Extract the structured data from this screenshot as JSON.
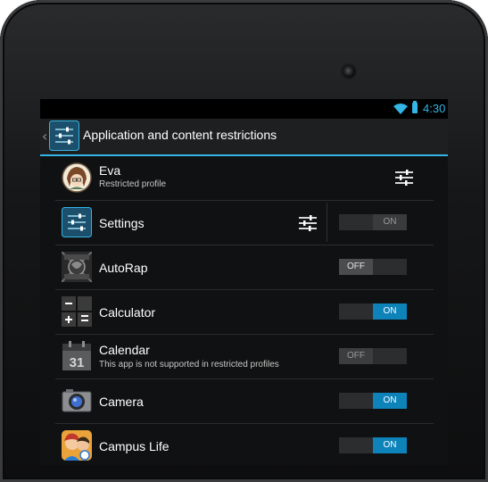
{
  "status_bar": {
    "time": "4:30",
    "wifi_icon": "wifi-icon",
    "battery_icon": "battery-icon",
    "accent": "#33b5e5"
  },
  "action_bar": {
    "title": "Application and content restrictions",
    "icon": "restrictions-sliders-icon"
  },
  "profile": {
    "name": "Eva",
    "subtitle": "Restricted profile",
    "avatar": "avatar-icon",
    "settings_icon": "tune-icon"
  },
  "apps": [
    {
      "name": "Settings",
      "icon": "settings-sliders-icon",
      "toggle": "ON",
      "state": "on",
      "enabled": false,
      "has_settings": true
    },
    {
      "name": "AutoRap",
      "icon": "autorap-icon",
      "toggle": "OFF",
      "state": "off",
      "enabled": true
    },
    {
      "name": "Calculator",
      "icon": "calculator-icon",
      "toggle": "ON",
      "state": "on",
      "enabled": true
    },
    {
      "name": "Calendar",
      "subtitle": "This app is not supported in restricted profiles",
      "icon": "calendar-icon",
      "icon_text": "31",
      "toggle": "OFF",
      "state": "off",
      "enabled": false
    },
    {
      "name": "Camera",
      "icon": "camera-icon",
      "toggle": "ON",
      "state": "on",
      "enabled": true
    },
    {
      "name": "Campus Life",
      "icon": "campus-life-icon",
      "toggle": "ON",
      "state": "on",
      "enabled": true
    }
  ],
  "colors": {
    "toggle_on": "#0e83b9",
    "toggle_off": "#4b4c4e",
    "background": "#101112"
  }
}
